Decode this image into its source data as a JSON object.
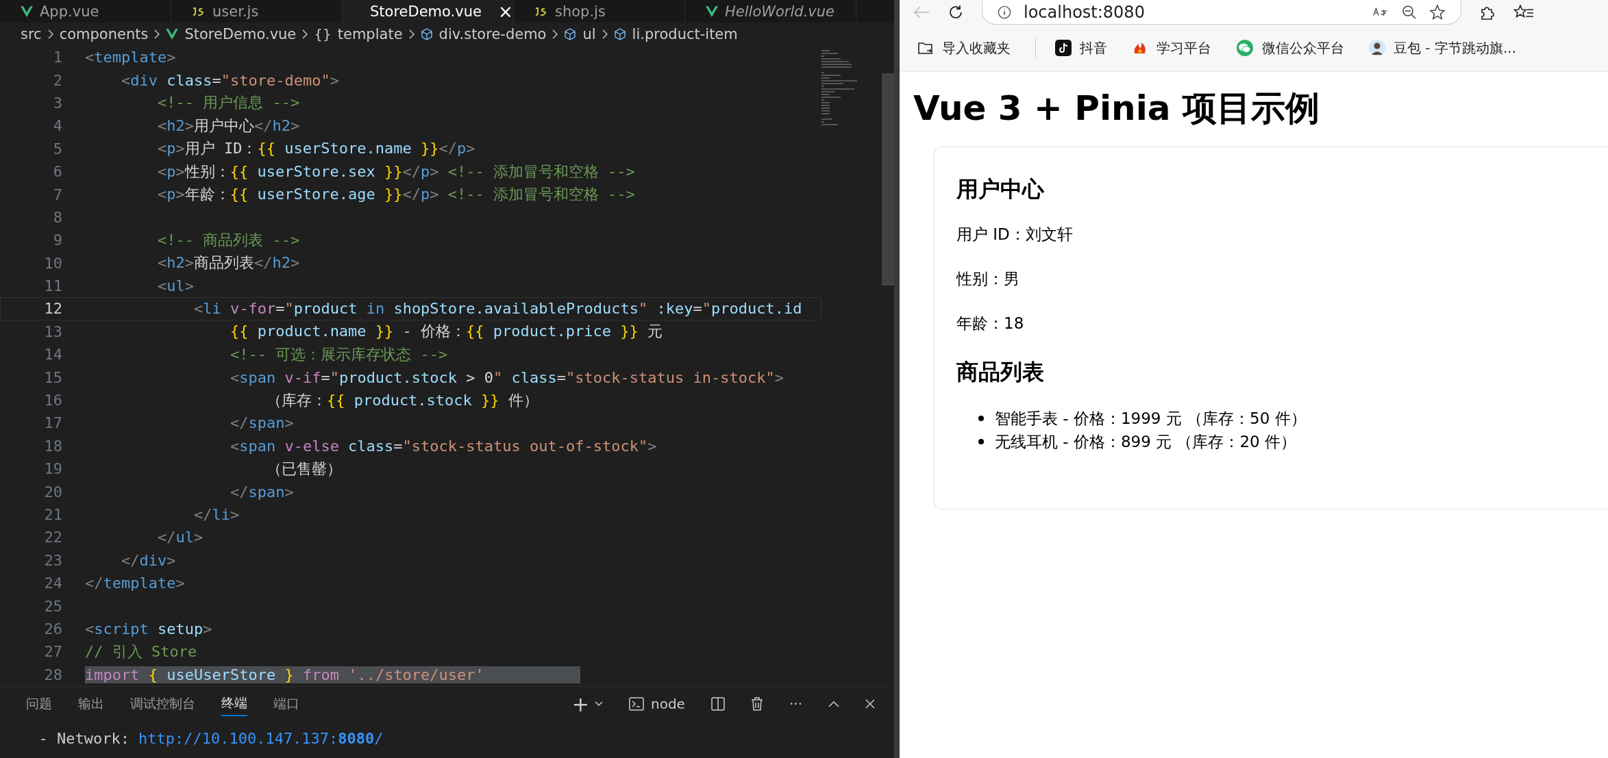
{
  "editor": {
    "tabs": [
      {
        "label": "App.vue",
        "kind": "vue",
        "selected": false,
        "preview": false
      },
      {
        "label": "user.js",
        "kind": "js",
        "selected": false,
        "preview": false
      },
      {
        "label": "StoreDemo.vue",
        "kind": "vue",
        "selected": true,
        "preview": false
      },
      {
        "label": "shop.js",
        "kind": "js",
        "selected": false,
        "preview": false
      },
      {
        "label": "HelloWorld.vue",
        "kind": "vue",
        "selected": false,
        "preview": true
      }
    ],
    "close_glyph": "×",
    "breadcrumb": [
      {
        "label": "src",
        "kind": "folder"
      },
      {
        "label": "components",
        "kind": "folder"
      },
      {
        "label": "StoreDemo.vue",
        "kind": "vue"
      },
      {
        "label": "template",
        "kind": "braces"
      },
      {
        "label": "div.store-demo",
        "kind": "element"
      },
      {
        "label": "ul",
        "kind": "element"
      },
      {
        "label": "li.product-item",
        "kind": "element"
      }
    ],
    "braces_glyph": "{}",
    "lines": [
      {
        "number": "1",
        "current": false,
        "selected": false,
        "tokens": [
          {
            "kind": "p",
            "text": "<"
          },
          {
            "kind": "tag",
            "text": "template"
          },
          {
            "kind": "p",
            "text": ">"
          }
        ]
      },
      {
        "number": "2",
        "current": false,
        "selected": false,
        "tokens": [
          {
            "kind": "p",
            "text": "    <"
          },
          {
            "kind": "tag",
            "text": "div"
          },
          {
            "kind": "attr",
            "text": " class"
          },
          {
            "kind": "tx",
            "text": "="
          },
          {
            "kind": "str",
            "text": "\"store-demo\""
          },
          {
            "kind": "p",
            "text": ">"
          }
        ]
      },
      {
        "number": "3",
        "current": false,
        "selected": false,
        "tokens": [
          {
            "kind": "cm",
            "text": "        <!-- 用户信息 -->"
          }
        ]
      },
      {
        "number": "4",
        "current": false,
        "selected": false,
        "tokens": [
          {
            "kind": "p",
            "text": "        <"
          },
          {
            "kind": "tag",
            "text": "h2"
          },
          {
            "kind": "p",
            "text": ">"
          },
          {
            "kind": "tx",
            "text": "用户中心"
          },
          {
            "kind": "p",
            "text": "</"
          },
          {
            "kind": "tag",
            "text": "h2"
          },
          {
            "kind": "p",
            "text": ">"
          }
        ]
      },
      {
        "number": "5",
        "current": false,
        "selected": false,
        "tokens": [
          {
            "kind": "p",
            "text": "        <"
          },
          {
            "kind": "tag",
            "text": "p"
          },
          {
            "kind": "p",
            "text": ">"
          },
          {
            "kind": "tx",
            "text": "用户 ID："
          },
          {
            "kind": "mu",
            "text": "{{"
          },
          {
            "kind": "var",
            "text": " userStore.name"
          },
          {
            "kind": "mu",
            "text": " }}"
          },
          {
            "kind": "p",
            "text": "</"
          },
          {
            "kind": "tag",
            "text": "p"
          },
          {
            "kind": "p",
            "text": ">"
          }
        ]
      },
      {
        "number": "6",
        "current": false,
        "selected": false,
        "tokens": [
          {
            "kind": "p",
            "text": "        <"
          },
          {
            "kind": "tag",
            "text": "p"
          },
          {
            "kind": "p",
            "text": ">"
          },
          {
            "kind": "tx",
            "text": "性别："
          },
          {
            "kind": "mu",
            "text": "{{"
          },
          {
            "kind": "var",
            "text": " userStore.sex"
          },
          {
            "kind": "mu",
            "text": " }}"
          },
          {
            "kind": "p",
            "text": "</"
          },
          {
            "kind": "tag",
            "text": "p"
          },
          {
            "kind": "p",
            "text": ">"
          },
          {
            "kind": "cm",
            "text": " <!-- 添加冒号和空格 -->"
          }
        ]
      },
      {
        "number": "7",
        "current": false,
        "selected": false,
        "tokens": [
          {
            "kind": "p",
            "text": "        <"
          },
          {
            "kind": "tag",
            "text": "p"
          },
          {
            "kind": "p",
            "text": ">"
          },
          {
            "kind": "tx",
            "text": "年龄："
          },
          {
            "kind": "mu",
            "text": "{{"
          },
          {
            "kind": "var",
            "text": " userStore.age"
          },
          {
            "kind": "mu",
            "text": " }}"
          },
          {
            "kind": "p",
            "text": "</"
          },
          {
            "kind": "tag",
            "text": "p"
          },
          {
            "kind": "p",
            "text": ">"
          },
          {
            "kind": "cm",
            "text": " <!-- 添加冒号和空格 -->"
          }
        ]
      },
      {
        "number": "8",
        "current": false,
        "selected": false
      },
      {
        "number": "9",
        "current": false,
        "selected": false,
        "tokens": [
          {
            "kind": "cm",
            "text": "        <!-- 商品列表 -->"
          }
        ]
      },
      {
        "number": "10",
        "current": false,
        "selected": false,
        "tokens": [
          {
            "kind": "p",
            "text": "        <"
          },
          {
            "kind": "tag",
            "text": "h2"
          },
          {
            "kind": "p",
            "text": ">"
          },
          {
            "kind": "tx",
            "text": "商品列表"
          },
          {
            "kind": "p",
            "text": "</"
          },
          {
            "kind": "tag",
            "text": "h2"
          },
          {
            "kind": "p",
            "text": ">"
          }
        ]
      },
      {
        "number": "11",
        "current": false,
        "selected": false,
        "tokens": [
          {
            "kind": "p",
            "text": "        <"
          },
          {
            "kind": "tag",
            "text": "ul"
          },
          {
            "kind": "p",
            "text": ">"
          }
        ]
      },
      {
        "number": "12",
        "current": true,
        "selected": false,
        "tokens": [
          {
            "kind": "p",
            "text": "            <"
          },
          {
            "kind": "tag",
            "text": "li"
          },
          {
            "kind": "dir",
            "text": " v-for"
          },
          {
            "kind": "tx",
            "text": "="
          },
          {
            "kind": "str",
            "text": "\""
          },
          {
            "kind": "var",
            "text": "product"
          },
          {
            "kind": "tag",
            "text": " in"
          },
          {
            "kind": "var",
            "text": " shopStore.availableProducts"
          },
          {
            "kind": "str",
            "text": "\""
          },
          {
            "kind": "attr",
            "text": " :key"
          },
          {
            "kind": "tx",
            "text": "="
          },
          {
            "kind": "str",
            "text": "\""
          },
          {
            "kind": "var",
            "text": "product.id"
          }
        ]
      },
      {
        "number": "13",
        "current": false,
        "selected": false,
        "tokens": [
          {
            "kind": "mu",
            "text": "                {{"
          },
          {
            "kind": "var",
            "text": " product.name"
          },
          {
            "kind": "mu",
            "text": " }}"
          },
          {
            "kind": "tx",
            "text": " - 价格："
          },
          {
            "kind": "mu",
            "text": "{{"
          },
          {
            "kind": "var",
            "text": " product.price"
          },
          {
            "kind": "mu",
            "text": " }}"
          },
          {
            "kind": "tx",
            "text": " 元"
          }
        ]
      },
      {
        "number": "14",
        "current": false,
        "selected": false,
        "tokens": [
          {
            "kind": "cm",
            "text": "                <!-- 可选：展示库存状态 -->"
          }
        ]
      },
      {
        "number": "15",
        "current": false,
        "selected": false,
        "tokens": [
          {
            "kind": "p",
            "text": "                <"
          },
          {
            "kind": "tag",
            "text": "span"
          },
          {
            "kind": "dir",
            "text": " v-if"
          },
          {
            "kind": "tx",
            "text": "="
          },
          {
            "kind": "str",
            "text": "\""
          },
          {
            "kind": "var",
            "text": "product.stock"
          },
          {
            "kind": "tx",
            "text": " > 0"
          },
          {
            "kind": "str",
            "text": "\""
          },
          {
            "kind": "attr",
            "text": " class"
          },
          {
            "kind": "tx",
            "text": "="
          },
          {
            "kind": "str",
            "text": "\"stock-status in-stock\""
          },
          {
            "kind": "p",
            "text": ">"
          }
        ]
      },
      {
        "number": "16",
        "current": false,
        "selected": false,
        "tokens": [
          {
            "kind": "tx",
            "text": "                    （库存："
          },
          {
            "kind": "mu",
            "text": "{{"
          },
          {
            "kind": "var",
            "text": " product.stock"
          },
          {
            "kind": "mu",
            "text": " }}"
          },
          {
            "kind": "tx",
            "text": " 件）"
          }
        ]
      },
      {
        "number": "17",
        "current": false,
        "selected": false,
        "tokens": [
          {
            "kind": "p",
            "text": "                </"
          },
          {
            "kind": "tag",
            "text": "span"
          },
          {
            "kind": "p",
            "text": ">"
          }
        ]
      },
      {
        "number": "18",
        "current": false,
        "selected": false,
        "tokens": [
          {
            "kind": "p",
            "text": "                <"
          },
          {
            "kind": "tag",
            "text": "span"
          },
          {
            "kind": "dir",
            "text": " v-else"
          },
          {
            "kind": "attr",
            "text": " class"
          },
          {
            "kind": "tx",
            "text": "="
          },
          {
            "kind": "str",
            "text": "\"stock-status out-of-stock\""
          },
          {
            "kind": "p",
            "text": ">"
          }
        ]
      },
      {
        "number": "19",
        "current": false,
        "selected": false,
        "tokens": [
          {
            "kind": "tx",
            "text": "                    （已售罄）"
          }
        ]
      },
      {
        "number": "20",
        "current": false,
        "selected": false,
        "tokens": [
          {
            "kind": "p",
            "text": "                </"
          },
          {
            "kind": "tag",
            "text": "span"
          },
          {
            "kind": "p",
            "text": ">"
          }
        ]
      },
      {
        "number": "21",
        "current": false,
        "selected": false,
        "tokens": [
          {
            "kind": "p",
            "text": "            </"
          },
          {
            "kind": "tag",
            "text": "li"
          },
          {
            "kind": "p",
            "text": ">"
          }
        ]
      },
      {
        "number": "22",
        "current": false,
        "selected": false,
        "tokens": [
          {
            "kind": "p",
            "text": "        </"
          },
          {
            "kind": "tag",
            "text": "ul"
          },
          {
            "kind": "p",
            "text": ">"
          }
        ]
      },
      {
        "number": "23",
        "current": false,
        "selected": false,
        "tokens": [
          {
            "kind": "p",
            "text": "    </"
          },
          {
            "kind": "tag",
            "text": "div"
          },
          {
            "kind": "p",
            "text": ">"
          }
        ]
      },
      {
        "number": "24",
        "current": false,
        "selected": false,
        "tokens": [
          {
            "kind": "p",
            "text": "</"
          },
          {
            "kind": "tag",
            "text": "template"
          },
          {
            "kind": "p",
            "text": ">"
          }
        ]
      },
      {
        "number": "25",
        "current": false,
        "selected": false
      },
      {
        "number": "26",
        "current": false,
        "selected": false,
        "tokens": [
          {
            "kind": "p",
            "text": "<"
          },
          {
            "kind": "tag",
            "text": "script"
          },
          {
            "kind": "attr",
            "text": " setup"
          },
          {
            "kind": "p",
            "text": ">"
          }
        ]
      },
      {
        "number": "27",
        "current": false,
        "selected": false,
        "tokens": [
          {
            "kind": "cm",
            "text": "// 引入 Store"
          }
        ]
      },
      {
        "number": "28",
        "current": false,
        "selected": true,
        "tokens": [
          {
            "kind": "kw",
            "text": "import"
          },
          {
            "kind": "mu",
            "text": " {"
          },
          {
            "kind": "var",
            "text": " useUserStore"
          },
          {
            "kind": "mu",
            "text": " }"
          },
          {
            "kind": "kw",
            "text": " from"
          },
          {
            "kind": "str",
            "text": " '../store/user'"
          }
        ]
      }
    ]
  },
  "panel": {
    "tabs": [
      {
        "label": "问题",
        "selected": false
      },
      {
        "label": "输出",
        "selected": false
      },
      {
        "label": "调试控制台",
        "selected": false
      },
      {
        "label": "终端",
        "selected": true
      },
      {
        "label": "端口",
        "selected": false
      }
    ],
    "plus_glyph": "+",
    "terminal_name": "node",
    "more_glyph": "···",
    "terminal_line": {
      "prefix": "  - Network:",
      "url": "http://10.100.147.137:**8080**/"
    }
  },
  "browser": {
    "address": "localhost:8080",
    "bookmarks": [
      {
        "label": "导入收藏夹",
        "kind": "folder"
      },
      {
        "label": "抖音",
        "kind": "note"
      },
      {
        "label": "学习平台",
        "kind": "flame"
      },
      {
        "label": "微信公众平台",
        "kind": "chat"
      },
      {
        "label": "豆包 - 字节跳动旗...",
        "kind": "avatar"
      }
    ],
    "page": {
      "title": "Vue 3 + Pinia 项目示例",
      "user_heading": "用户中心",
      "user_lines": [
        "用户 ID：刘文轩",
        "性别：男",
        "年龄：18"
      ],
      "products_heading": "商品列表",
      "products": [
        "智能手表 - 价格：1999 元 （库存：50 件）",
        "无线耳机 - 价格：899 元 （库存：20 件）"
      ]
    }
  }
}
